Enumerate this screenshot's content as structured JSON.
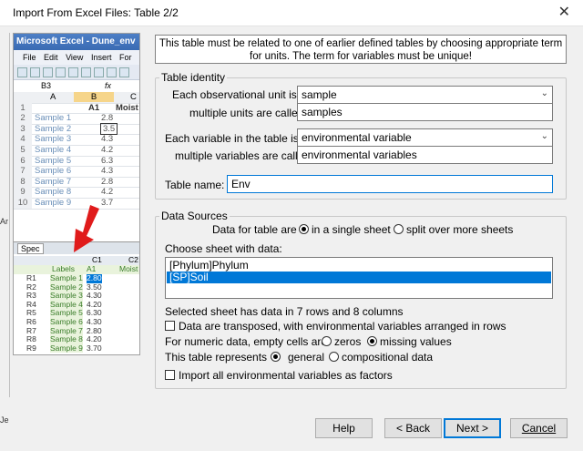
{
  "window": {
    "title": "Import From Excel Files: Table 2/2",
    "close_glyph": "✕"
  },
  "preview": {
    "excel_title": "Microsoft Excel - Dune_env",
    "menu": [
      "File",
      "Edit",
      "View",
      "Insert",
      "For"
    ],
    "name_box": "B3",
    "fx": "fx",
    "col_headers": [
      "A",
      "B",
      "C"
    ],
    "header_row": {
      "num": "1",
      "b": "A1",
      "c": "Moist"
    },
    "rows": [
      {
        "num": "2",
        "a": "Sample 1",
        "b": "2.8"
      },
      {
        "num": "3",
        "a": "Sample 2",
        "b": "3.5"
      },
      {
        "num": "4",
        "a": "Sample 3",
        "b": "4.3"
      },
      {
        "num": "5",
        "a": "Sample 4",
        "b": "4.2"
      },
      {
        "num": "6",
        "a": "Sample 5",
        "b": "6.3"
      },
      {
        "num": "7",
        "a": "Sample 6",
        "b": "4.3"
      },
      {
        "num": "8",
        "a": "Sample 7",
        "b": "2.8"
      },
      {
        "num": "9",
        "a": "Sample 8",
        "b": "4.2"
      },
      {
        "num": "10",
        "a": "Sample 9",
        "b": "3.7"
      }
    ],
    "sheet_tab": "Spec",
    "grid2_header": {
      "labels": "Labels",
      "a1": "A1",
      "moist": "Moist",
      "c1": "C1",
      "c2": "C2"
    },
    "grid2_rows": [
      {
        "r": "R1",
        "s": "Sample 1",
        "v": "2.80"
      },
      {
        "r": "R2",
        "s": "Sample 2",
        "v": "3.50"
      },
      {
        "r": "R3",
        "s": "Sample 3",
        "v": "4.30"
      },
      {
        "r": "R4",
        "s": "Sample 4",
        "v": "4.20"
      },
      {
        "r": "R5",
        "s": "Sample 5",
        "v": "6.30"
      },
      {
        "r": "R6",
        "s": "Sample 6",
        "v": "4.30"
      },
      {
        "r": "R7",
        "s": "Sample 7",
        "v": "2.80"
      },
      {
        "r": "R8",
        "s": "Sample 8",
        "v": "4.20"
      },
      {
        "r": "R9",
        "s": "Sample 9",
        "v": "3.70"
      }
    ],
    "left_edge": [
      "Ar",
      "Je"
    ]
  },
  "info": {
    "line1": "This table must be related to one of earlier defined tables by choosing appropriate term",
    "line2": "for units. The term for variables must be unique!"
  },
  "table_identity": {
    "legend": "Table identity",
    "unit_label": "Each observational unit is a",
    "unit_value": "sample",
    "units_label": "multiple units are called",
    "units_value": "samples",
    "variable_label": "Each variable in the table is a",
    "variable_value": "environmental variable",
    "variables_label": "multiple variables are called",
    "variables_value": "environmental variables",
    "name_label": "Table name:",
    "name_value": "Env"
  },
  "data_sources": {
    "legend": "Data Sources",
    "data_for_table_label": "Data for table are",
    "single_sheet": "in a single sheet",
    "split_sheets": "split over more sheets",
    "choose_sheet_label": "Choose sheet with data:",
    "sheets": [
      "[Phylum]Phylum",
      "[SP]Soil"
    ],
    "summary": "Selected sheet has data in 7 rows and 8 columns",
    "transposed": "Data are transposed, with environmental variables arranged in rows",
    "empty_cells_label": "For numeric data, empty cells are",
    "zeros": "zeros",
    "missing_values": "missing values",
    "represents_label": "This table represents",
    "general": "general",
    "compositional": "compositional data",
    "factors": "Import all environmental variables as factors"
  },
  "buttons": {
    "help": "Help",
    "back": "< Back",
    "next": "Next >",
    "cancel": "Cancel"
  },
  "colors": {
    "selection": "#0078d7",
    "arrow": "#e01b1b",
    "excel_title": "#3a6bb3"
  }
}
